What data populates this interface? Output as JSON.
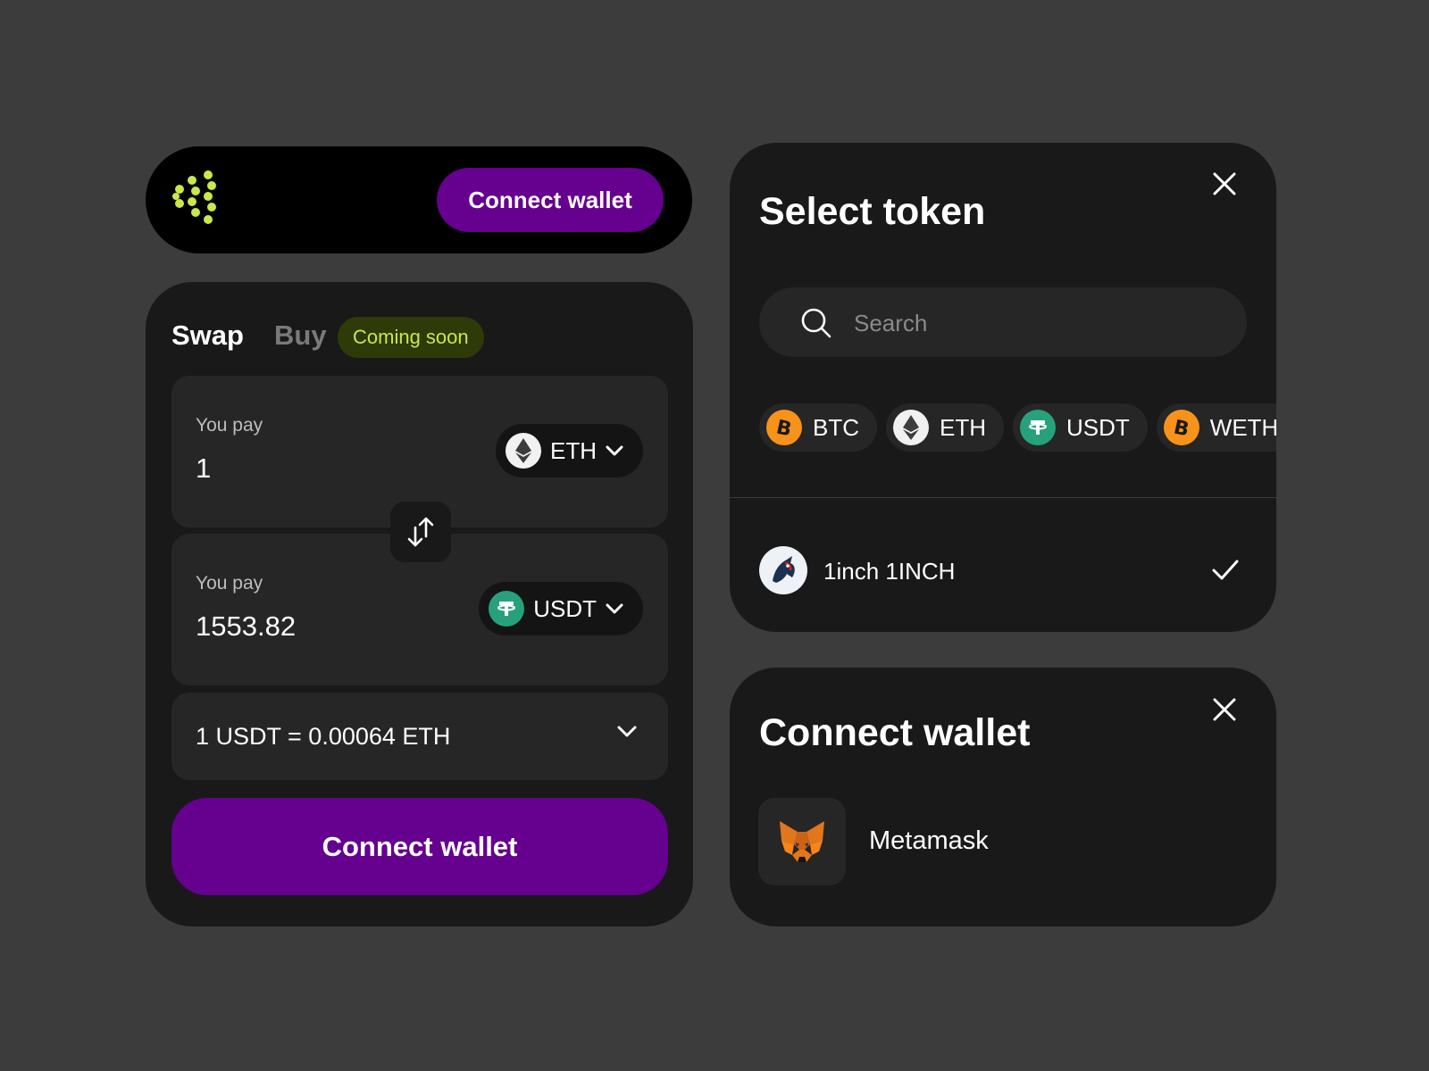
{
  "header": {
    "connect_label": "Connect wallet"
  },
  "swap": {
    "tabs": [
      {
        "label": "Swap",
        "active": true
      },
      {
        "label": "Buy",
        "active": false
      }
    ],
    "badge": "Coming soon",
    "pay": {
      "label": "You pay",
      "value": "1",
      "token": "ETH"
    },
    "receive": {
      "label": "You pay",
      "value": "1553.82",
      "token": "USDT"
    },
    "rate": "1 USDT = 0.00064 ETH",
    "connect_label": "Connect wallet"
  },
  "select_token": {
    "title": "Select token",
    "search_placeholder": "Search",
    "chips": [
      "BTC",
      "ETH",
      "USDT",
      "WETH"
    ],
    "list": [
      {
        "label": "1inch 1INCH",
        "selected": true
      }
    ]
  },
  "connect_wallet": {
    "title": "Connect wallet",
    "wallets": [
      {
        "label": "Metamask"
      }
    ]
  },
  "colors": {
    "accent": "#66008f",
    "brand_green": "#c9e84a",
    "panel": "#191919",
    "background": "#3c3c3c"
  },
  "icons": [
    "brand-logo-icon",
    "eth-icon",
    "usdt-icon",
    "btc-icon",
    "chevron-down-icon",
    "swap-arrows-icon",
    "close-icon",
    "search-icon",
    "check-icon",
    "oneinch-icon",
    "metamask-icon"
  ]
}
